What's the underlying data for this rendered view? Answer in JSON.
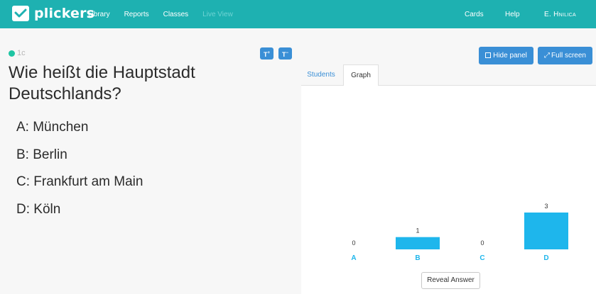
{
  "app": {
    "name": "plickers"
  },
  "nav": {
    "left": [
      "Library",
      "Reports",
      "Classes",
      "Live View"
    ],
    "cards": "Cards",
    "help": "Help",
    "user": "E. Hnilica"
  },
  "question": {
    "code": "1c",
    "text": "Wie heißt die Hauptstadt Deutschlands?",
    "size_up_label": "T",
    "size_down_label": "T",
    "choices": [
      "A: München",
      "B: Berlin",
      "C: Frankfurt am Main",
      "D: Köln"
    ]
  },
  "panel": {
    "hide_label": "Hide panel",
    "fullscreen_label": "Full screen",
    "tabs": [
      "Students",
      "Graph"
    ],
    "reveal_label": "Reveal Answer"
  },
  "colors": {
    "brand": "#1eb1b1",
    "button": "#3a8fd6",
    "bar": "#1eb6ec",
    "status": "#1fc5a3"
  },
  "chart_data": {
    "type": "bar",
    "categories": [
      "A",
      "B",
      "C",
      "D"
    ],
    "values": [
      0,
      1,
      0,
      3
    ],
    "ylim": [
      0,
      3
    ]
  }
}
